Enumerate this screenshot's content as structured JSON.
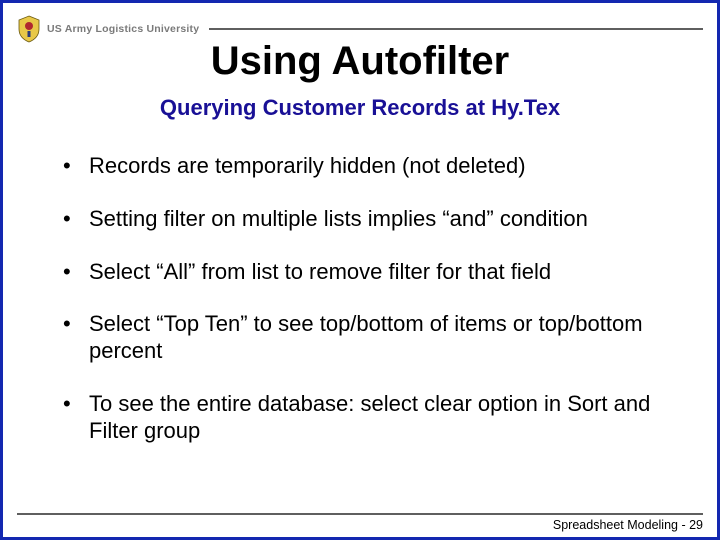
{
  "header": {
    "org": "US Army Logistics University"
  },
  "title": "Using Autofilter",
  "subtitle": "Querying Customer Records at Hy.Tex",
  "bullets": [
    "Records are temporarily hidden (not deleted)",
    "Setting filter on multiple lists implies  “and” condition",
    "Select “All” from list to remove filter for that field",
    "Select “Top Ten” to see top/bottom of items or top/bottom percent",
    "To see the entire database:  select clear option in Sort and Filter group"
  ],
  "footer": "Spreadsheet Modeling - 29"
}
